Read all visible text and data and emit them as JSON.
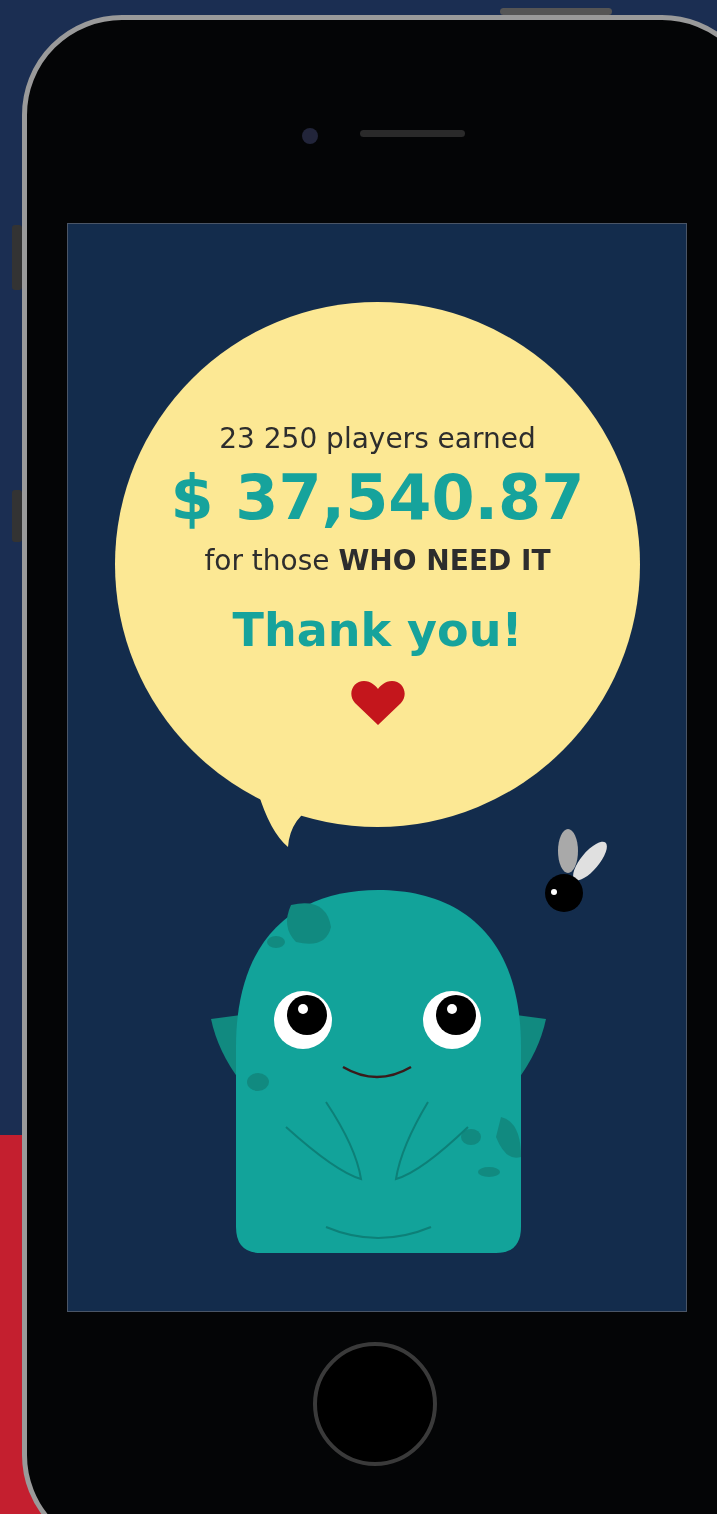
{
  "screen": {
    "players_line": "23 250 players earned",
    "amount": "$ 37,540.87",
    "need_line": "for those **WHO NEED IT**",
    "thanks": "Thank you!"
  }
}
